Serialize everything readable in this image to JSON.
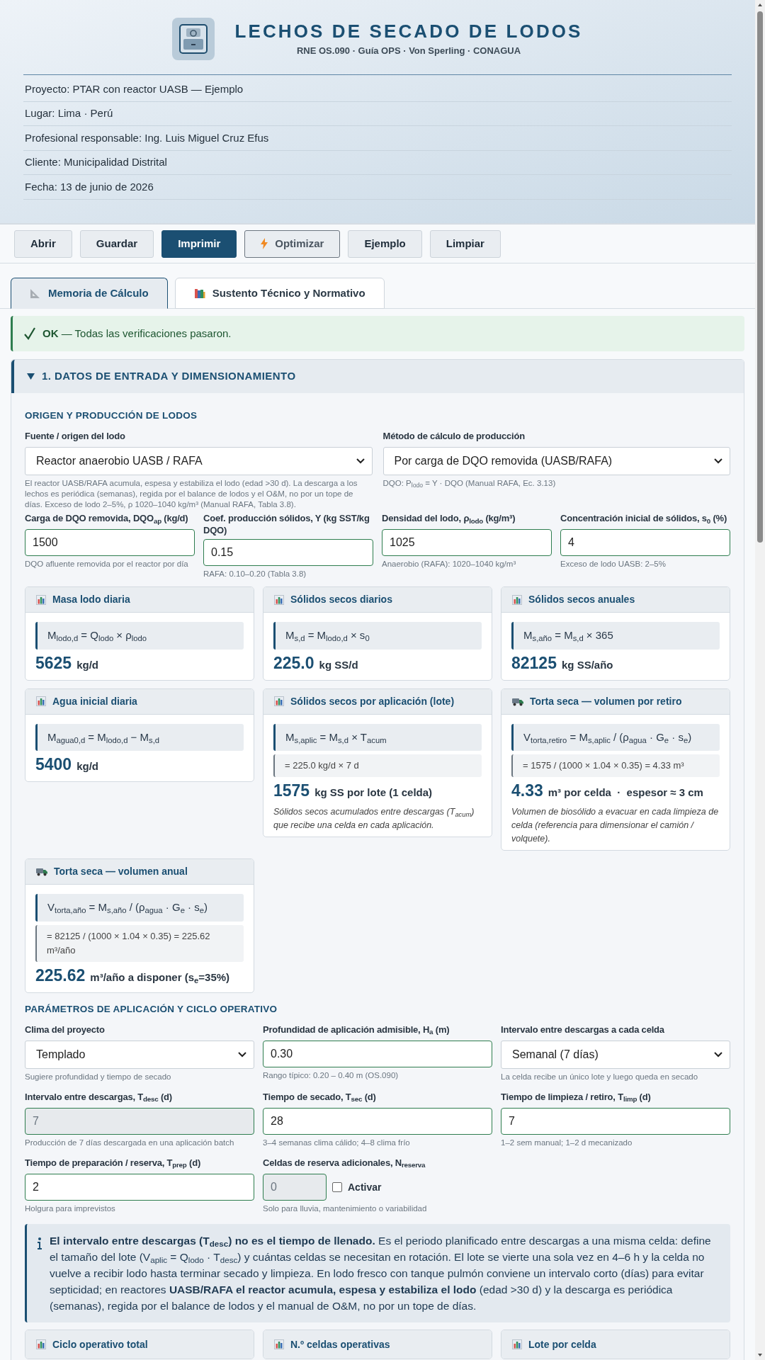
{
  "header": {
    "title": "LECHOS DE SECADO DE LODOS",
    "subtitle": "RNE OS.090 · Guía OPS · Von Sperling · CONAGUA",
    "info_lines": [
      "Proyecto: PTAR con reactor UASB — Ejemplo",
      "Lugar: Lima · Perú",
      "Profesional responsable: Ing. Luis Miguel Cruz Efus",
      "Cliente: Municipalidad Distrital",
      "Fecha: 13 de junio de 2026"
    ]
  },
  "toolbar": {
    "buttons": [
      {
        "label": "Abrir",
        "kind": "default"
      },
      {
        "label": "Guardar",
        "kind": "default"
      },
      {
        "label": "Imprimir",
        "kind": "primary"
      },
      {
        "label": "Optimizar",
        "kind": "accent"
      },
      {
        "label": "Ejemplo",
        "kind": "default"
      },
      {
        "label": "Limpiar",
        "kind": "default"
      }
    ]
  },
  "tabs": [
    {
      "label": "Memoria de Cálculo",
      "selected": true
    },
    {
      "label": "Sustento Técnico y Normativo",
      "selected": false
    }
  ],
  "alert": {
    "kind": "success",
    "status": "OK",
    "message": "— Todas las verificaciones pasaron."
  },
  "section": {
    "title": "1. DATOS DE ENTRADA Y DIMENSIONAMIENTO",
    "expanded": true,
    "groups": [
      {
        "heading": "ORIGEN Y PRODUCCIÓN DE LODOS",
        "fields": [
          {
            "kind": "select",
            "label": "Fuente / origen del lodo",
            "value": "Reactor anaerobio UASB / RAFA",
            "hint": "El reactor UASB/RAFA acumula, espesa y estabiliza el lodo (edad >30 d). La descarga a los lechos es periódica (semanas), regida por el balance de lodos y el O&M, no por un tope de días. Exceso de lodo 2–5%, ρ 1020–1040 kg/m³ (Manual RAFA, Tabla 3.8)."
          },
          {
            "kind": "select",
            "label": "Método de cálculo de producción",
            "value": "Por carga de DQO removida (UASB/RAFA)",
            "hint": "DQO: P$_{lodo}$ = Y · DQO (Manual RAFA, Ec. 3.13)"
          }
        ]
      },
      {
        "fields": [
          {
            "kind": "input",
            "label": "Carga de DQO removida, DQO$_{ap}$ (kg/d)",
            "value": "1500",
            "hint": "DQO afluente removida por el reactor por día"
          },
          {
            "kind": "input",
            "label": "Coef. producción sólidos, Y (kg SST/kg DQO)",
            "value": "0.15",
            "hint": "RAFA: 0.10–0.20 (Tabla 3.8)"
          },
          {
            "kind": "input",
            "label": "Densidad del lodo, ρ$_{lodo}$ (kg/m³)",
            "value": "1025",
            "hint": "Anaerobio (RAFA): 1020–1040 kg/m³"
          },
          {
            "kind": "input",
            "label": "Concentración inicial de sólidos, s$_{0}$ (%)",
            "value": "4",
            "hint": "Exceso de lodo UASB: 2–5%"
          }
        ]
      },
      {
        "kind": "cards",
        "cards": [
          {
            "kind": "mass",
            "title": "Masa lodo diaria",
            "formula": "M$_{lodo,d}$ = Q$_{lodo}$ × ρ$_{lodo}$",
            "value": "5625",
            "unit": "kg/d"
          },
          {
            "kind": "mass",
            "title": "Sólidos secos diarios",
            "formula": "M$_{s,d}$ = M$_{lodo,d}$ × s$_{0}$",
            "value": "225.0",
            "unit": "kg SS/d"
          },
          {
            "kind": "mass",
            "title": "Sólidos secos anuales",
            "formula": "M$_{s,año}$ = M$_{s,d}$ × 365",
            "value": "82125",
            "unit": "kg SS/año"
          },
          {
            "kind": "mass",
            "title": "Agua inicial diaria",
            "formula": "M$_{agua0,d}$ = M$_{lodo,d}$ − M$_{s,d}$",
            "value": "5400",
            "unit": "kg/d"
          },
          {
            "kind": "mass",
            "title": "Sólidos secos por aplicación (lote)",
            "formula": "M$_{s,aplic}$ = M$_{s,d}$ × T$_{acum}$",
            "substitution": "= 225.0 kg/d × 7 d",
            "value": "1575",
            "unit": "kg SS por lote (1 celda)",
            "note": "Sólidos secos acumulados entre descargas (T$_{acum}$) que recibe una celda en cada aplicación."
          },
          {
            "kind": "volume",
            "title": "Torta seca — volumen por retiro",
            "formula": "V$_{torta,retiro}$ = M$_{s,aplic}$ / (ρ$_{agua}$ · G$_{e}$ · s$_{e}$)",
            "substitution": "= 1575 / (1000 × 1.04 × 0.35) = 4.33 m³",
            "value": "4.33",
            "unit": "m³ por celda  ·  espesor ≈ 3 cm",
            "note": "Volumen de biosólido a evacuar en cada limpieza de celda (referencia para dimensionar el camión / volquete)."
          },
          {
            "kind": "volume",
            "title": "Torta seca — volumen anual",
            "formula": "V$_{torta,año}$ = M$_{s,año}$ / (ρ$_{agua}$ · G$_{e}$ · s$_{e}$)",
            "substitution": "= 82125 / (1000 × 1.04 × 0.35) = 225.62 m³/año",
            "value": "225.62",
            "unit": "m³/año a disponer (s$_{e}$=35%)"
          }
        ]
      },
      {
        "heading": "PARÁMETROS DE APLICACIÓN Y CICLO OPERATIVO",
        "fields": [
          {
            "kind": "select",
            "label": "Clima del proyecto",
            "value": "Templado",
            "hint": "Sugiere profundidad y tiempo de secado"
          },
          {
            "kind": "input",
            "label": "Profundidad de aplicación admisible, H$_{a}$ (m)",
            "value": "0.30",
            "hint": "Rango típico: 0.20 – 0.40 m (OS.090)"
          },
          {
            "kind": "select",
            "label": "Intervalo entre descargas a cada celda",
            "value": "Semanal (7 días)",
            "hint": "La celda recibe un único lote y luego queda en secado"
          },
          {
            "kind": "input",
            "label": "Intervalo entre descargas, T$_{desc}$ (d)",
            "value": "7",
            "disabled": true,
            "hint": "Producción de 7 días descargada en una aplicación batch"
          },
          {
            "kind": "input",
            "label": "Tiempo de secado, T$_{sec}$ (d)",
            "value": "28",
            "disabled": false,
            "hint": "3–4 semanas clima cálido; 4–8 clima frío"
          },
          {
            "kind": "input",
            "label": "Tiempo de limpieza / retiro, T$_{limp}$ (d)",
            "value": "7",
            "disabled": false,
            "hint": "1–2 sem manual; 1–2 d mecanizado"
          },
          {
            "kind": "input",
            "label": "Tiempo de preparación / reserva, T$_{prep}$ (d)",
            "value": "2",
            "disabled": false,
            "hint": "Holgura para imprevistos"
          },
          {
            "kind": "toggle-input",
            "label": "Celdas de reserva adicionales, N$_{reserva}$",
            "value": "0",
            "disabled": true,
            "checkbox": {
              "label": "Activar",
              "checked": false
            },
            "hint": "Solo para lluvia, mantenimiento o variabilidad"
          }
        ]
      },
      {
        "kind": "info",
        "text": "**El intervalo entre descargas (T$_{desc}$) no es el tiempo de llenado.** Es el periodo planificado entre descargas a una misma celda: define el tamaño del lote (V$_{aplic}$ = Q$_{lodo}$ · T$_{desc}$) y cuántas celdas se necesitan en rotación. El lote se vierte una sola vez en 4–6 h y la celda no vuelve a recibir lodo hasta terminar secado y limpieza. En lodo fresco con tanque pulmón conviene un intervalo corto (días) para evitar septicidad; en reactores **UASB/RAFA el reactor acumula, espesa y estabiliza el lodo** (edad >30 d) y la descarga es periódica (semanas), regida por el balance de lodos y el manual de O&M, no por un tope de días."
      },
      {
        "kind": "cards",
        "cards": [
          {
            "kind": "mass",
            "title": "Ciclo operativo total"
          },
          {
            "kind": "mass",
            "title": "N.º celdas operativas"
          },
          {
            "kind": "mass",
            "title": "Lote por celda"
          }
        ]
      }
    ]
  }
}
